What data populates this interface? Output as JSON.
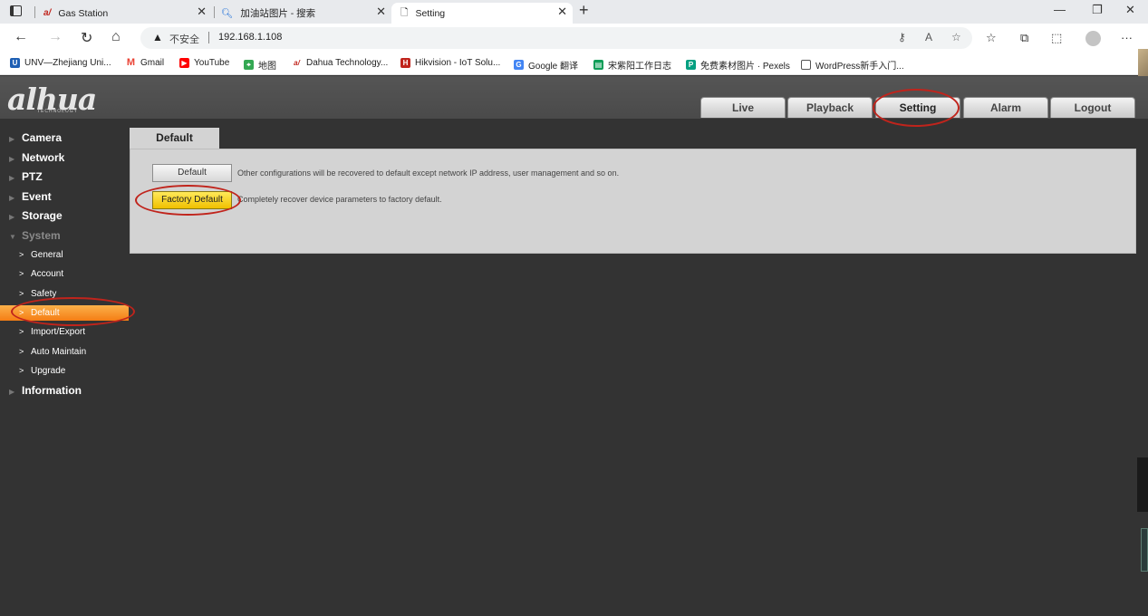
{
  "browser": {
    "tabs": [
      {
        "title": "Gas Station",
        "icon": "dahua-favicon"
      },
      {
        "title": "加油站图片 - 搜索",
        "icon": "search-favicon"
      },
      {
        "title": "Setting",
        "icon": "page-favicon"
      }
    ],
    "address": {
      "security_label": "不安全",
      "url": "192.168.1.108"
    },
    "bookmarks": [
      {
        "label": "UNV—Zhejiang Uni...",
        "color": "#1e5fb4"
      },
      {
        "label": "Gmail",
        "color": "#ea4335"
      },
      {
        "label": "YouTube",
        "color": "#ff0000"
      },
      {
        "label": "地图",
        "color": "#34a853"
      },
      {
        "label": "Dahua Technology...",
        "color": "#c0241c"
      },
      {
        "label": "Hikvision - IoT Solu...",
        "color": "#c0241c"
      },
      {
        "label": "Google 翻译",
        "color": "#4285f4"
      },
      {
        "label": "宋紫阳工作日志",
        "color": "#0f9d58"
      },
      {
        "label": "免费素材图片 · Pexels",
        "color": "#05a081"
      },
      {
        "label": "WordPress新手入门...",
        "color": "#555555"
      }
    ]
  },
  "app": {
    "logo": "alhua",
    "logo_sub": "TECHNOLOGY",
    "nav": [
      "Live",
      "Playback",
      "Setting",
      "Alarm",
      "Logout"
    ],
    "active_nav": "Setting",
    "sidebar": {
      "sections": [
        "Camera",
        "Network",
        "PTZ",
        "Event",
        "Storage",
        "System"
      ],
      "system_items": [
        "General",
        "Account",
        "Safety",
        "Default",
        "Import/Export",
        "Auto Maintain",
        "Upgrade"
      ],
      "active_item": "Default",
      "last_section": "Information"
    },
    "content": {
      "tab": "Default",
      "default_button": "Default",
      "default_desc": "Other configurations will be recovered to default except network IP address, user management and so on.",
      "factory_button": "Factory Default",
      "factory_desc": "Completely recover device parameters to factory default."
    },
    "highlight_color": "#c0241c",
    "accent_orange": "#f57d14"
  }
}
